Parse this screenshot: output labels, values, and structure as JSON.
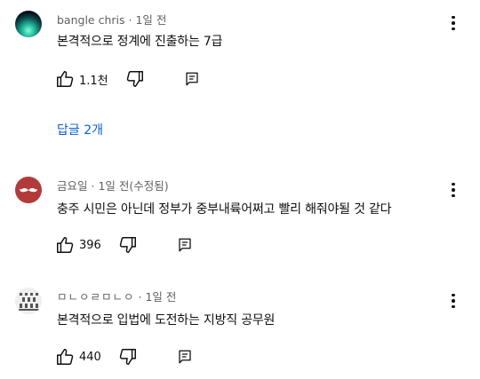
{
  "comments": [
    {
      "author": "bangle chris",
      "time": "· 1일 전",
      "text": "본격적으로 정계에 진출하는 7급",
      "likes": "1.1천",
      "replies_label": "답글 2개",
      "avatar": "gradient-orb-avatar"
    },
    {
      "author": "금요일",
      "time": "· 1일 전(수정됨)",
      "text": "충주 시민은 아닌데 정부가 중부내륙어쩌고 빨리 해줘야될 것 같다",
      "likes": "396",
      "avatar": "mustache-avatar"
    },
    {
      "author": "ㅁㄴㅇㄹㅁㄴㅇ",
      "time": "· 1일 전",
      "text": "본격적으로 입법에 도전하는 지방직 공무원",
      "likes": "440",
      "avatar": "chess-pattern-avatar"
    }
  ],
  "icons": {
    "like": "thumb-up-icon",
    "dislike": "thumb-down-icon",
    "reply": "reply-icon",
    "menu": "more-vert-icon"
  },
  "colors": {
    "link": "#065fd4",
    "meta": "#606060",
    "text": "#0f0f0f",
    "mustache_bg": "#b23a3a"
  }
}
